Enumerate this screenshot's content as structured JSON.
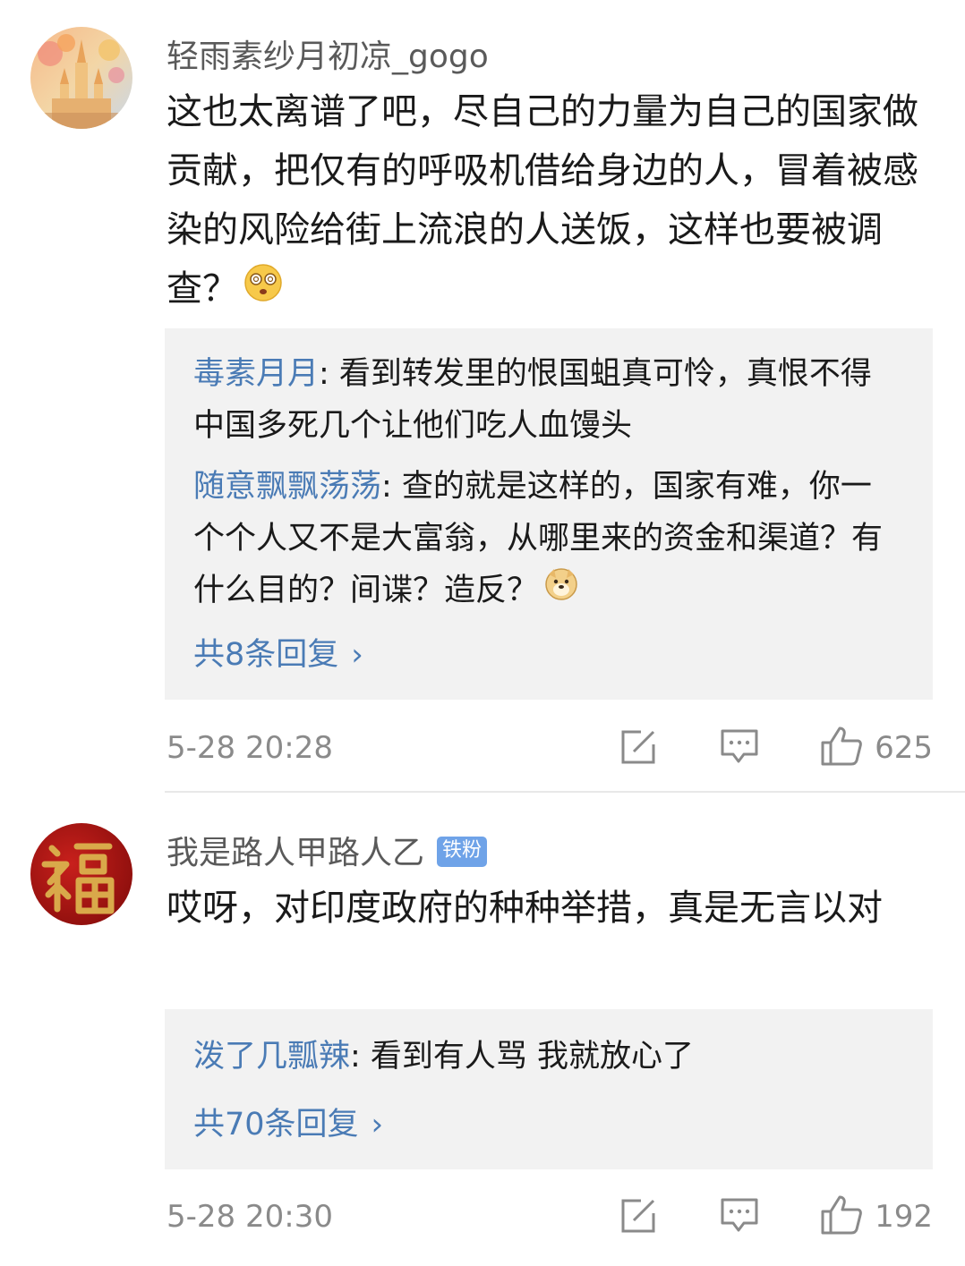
{
  "comments": [
    {
      "username": "轻雨素纱月初凉_gogo",
      "text": "这也太离谱了吧，尽自己的力量为自己的国家做贡献，把仅有的呼吸机借给身边的人，冒着被感染的风险给街上流浪的人送饭，这样也要被调查？",
      "emoji": "dizzy-face-emoji",
      "replies": [
        {
          "name": "毒素月月",
          "text": ": 看到转发里的恨国蛆真可怜，真恨不得中国多死几个让他们吃人血馒头"
        },
        {
          "name": "随意飘飘荡荡",
          "text": ": 查的就是这样的，国家有难，你一个个人又不是大富翁，从哪里来的资金和渠道？有什么目的？间谍？造反？",
          "emoji": "doge-emoji"
        }
      ],
      "more_replies": "共8条回复",
      "time": "5-28 20:28",
      "likes": "625"
    },
    {
      "username": "我是路人甲路人乙",
      "badge": "铁粉",
      "text": "哎呀，对印度政府的种种举措，真是无言以对",
      "replies": [
        {
          "name": "泼了几瓢辣",
          "text": ": 看到有人骂 我就放心了"
        }
      ],
      "more_replies": "共70条回复",
      "time": "5-28 20:30",
      "likes": "192"
    }
  ],
  "icons": {
    "repost": "repost-icon",
    "comment": "comment-icon",
    "like": "thumbs-up-icon"
  },
  "colors": {
    "link": "#4a7bb5",
    "badge": "#6fa3e8",
    "reply_bg": "#f2f2f2",
    "meta": "#8a8a8a"
  }
}
